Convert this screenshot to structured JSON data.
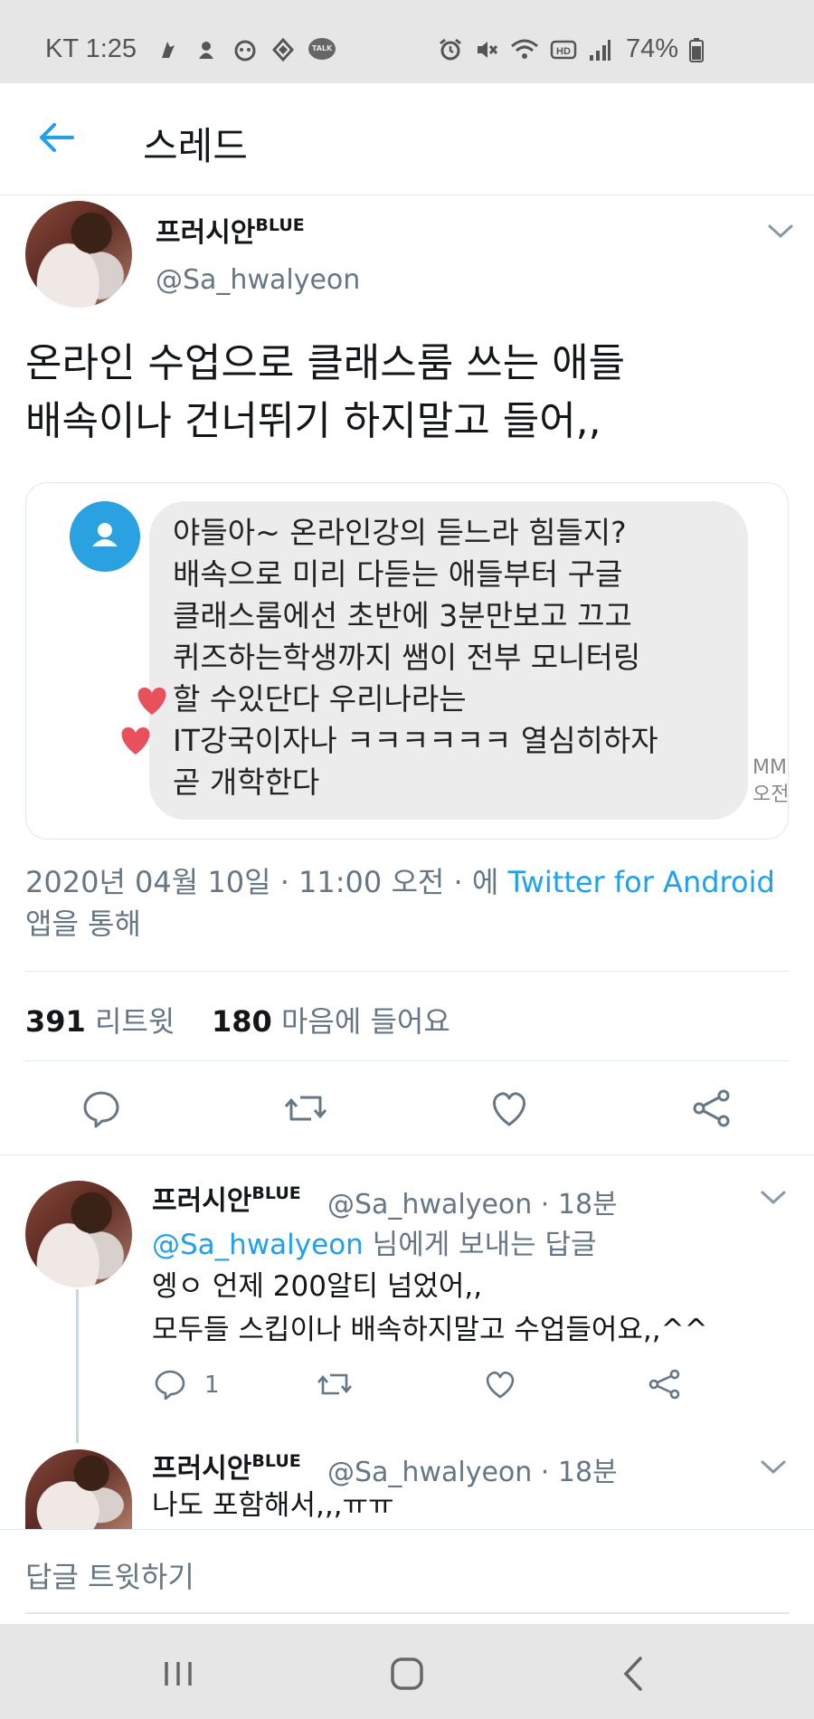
{
  "status_bar": {
    "carrier_time": "KT 1:25",
    "battery": "74%"
  },
  "header": {
    "title": "스레드"
  },
  "main_tweet": {
    "name": "프러시안",
    "name_sup": "BLUE",
    "handle": "@Sa_hwalyeon",
    "text": "온라인 수업으로 클래스룸 쓰는 애들\n배속이나 건너뛰기 하지말고 들어,,",
    "message_image": {
      "bubble_text": "야들아~ 온라인강의 듣느라 힘들지?\n배속으로 미리 다듣는 애들부터 구글\n클래스룸에선 초반에 3분만보고 끄고\n퀴즈하는학생까지 쌤이 전부 모니터링\n할 수있단다 우리나라는\nIT강국이자나 ㅋㅋㅋㅋㅋㅋ 열심히하자\n곧 개학한다",
      "mms_label": "MMS",
      "time_label": "오전"
    },
    "date": "2020년 04월 10일 · 11:00 오전 · 에 ",
    "source_link": "Twitter for Android",
    "source_suffix": "앱을 통해",
    "retweets": "391",
    "retweets_label": "리트윗",
    "likes": "180",
    "likes_label": "마음에 들어요"
  },
  "replies": [
    {
      "name": "프러시안",
      "name_sup": "BLUE",
      "meta": "@Sa_hwalyeon · 18분",
      "reply_to_link": "@Sa_hwalyeon",
      "reply_to_suffix": " 님에게 보내는 답글",
      "text": "엥ㅇ 언제 200알티 넘었어,,\n모두들 스킵이나 배속하지말고 수업들어요,,^^",
      "reply_count": "1"
    },
    {
      "name": "프러시안",
      "name_sup": "BLUE",
      "meta": "@Sa_hwalyeon · 18분",
      "text": "나도 포함해서,,,ㅠㅠ"
    }
  ],
  "compose": {
    "placeholder": "답글 트윗하기"
  },
  "colors": {
    "accent": "#1da1f2",
    "secondary_text": "#657786",
    "divider": "#e1e8ed"
  }
}
